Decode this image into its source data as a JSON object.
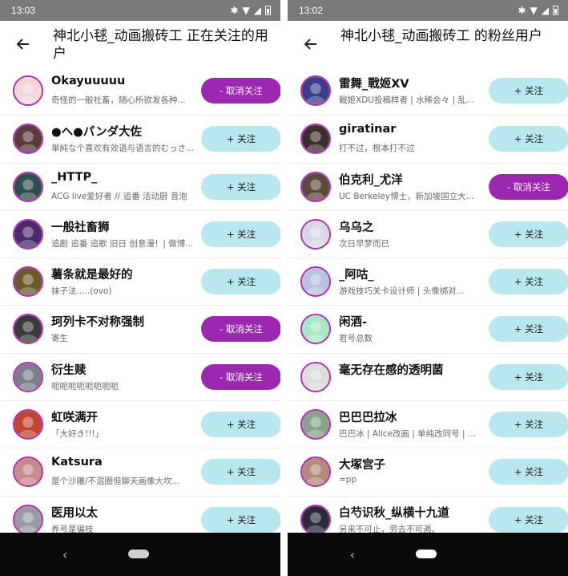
{
  "colors": {
    "accent_purple": "#9c27b0",
    "follow_bg": "#b8e7ef",
    "status_gray": "#7a7a7a",
    "nav_black": "#0a0a0a"
  },
  "icons": {
    "back": "arrow-left-icon",
    "bluetooth": "bluetooth-icon",
    "wifi": "wifi-icon",
    "signal": "signal-icon",
    "battery": "battery-icon"
  },
  "screens": [
    {
      "status_time": "13:03",
      "title": "神北小毬_动画搬砖工 正在关注的用户",
      "users": [
        {
          "name": "Okayuuuuu",
          "sig": "奇怪的一般社畜，随心所欲发各种...",
          "button": "- 取消关注",
          "state": "unfollow",
          "color": "#f3d6d6"
        },
        {
          "name": "●へ●パンダ大佐",
          "sig": "単純な个喜欢有效语与语言的むっさ...",
          "button": "+ 关注",
          "state": "follow",
          "color": "#5a3a3a"
        },
        {
          "name": "_HTTP_",
          "sig": "ACG live爱好者 // 追番 活动厨 音泡",
          "button": "+ 关注",
          "state": "follow",
          "color": "#2f4f4f"
        },
        {
          "name": "一般社畜狮",
          "sig": "追剧 追番 追歌 旧日 创意漫！| 做博...",
          "button": "+ 关注",
          "state": "follow",
          "color": "#4b2a6b"
        },
        {
          "name": "薯条就是最好的",
          "sig": "抹子法.....(ovo)",
          "button": "+ 关注",
          "state": "follow",
          "color": "#6b5a2a"
        },
        {
          "name": "珂列卡不对称强制",
          "sig": "寄生",
          "button": "- 取消关注",
          "state": "unfollow",
          "color": "#3a3a3a"
        },
        {
          "name": "衍生赎",
          "sig": "呃呃呃呃呃呃呃呃",
          "button": "- 取消关注",
          "state": "unfollow",
          "color": "#7d7d8c"
        },
        {
          "name": "虹咲满开",
          "sig": "「大好き!!!」",
          "button": "+ 关注",
          "state": "follow",
          "color": "#c2452f"
        },
        {
          "name": "Katsura",
          "sig": "是个沙雕/不混圈但聊天画像大坎...",
          "button": "+ 关注",
          "state": "follow",
          "color": "#c58a8a"
        },
        {
          "name": "医用以太",
          "sig": "养号是骗技",
          "button": "+ 关注",
          "state": "follow",
          "color": "#9a9aa6"
        }
      ]
    },
    {
      "status_time": "13:02",
      "title": "神北小毬_动画搬砖工 的粉丝用户",
      "users": [
        {
          "name": "雷舞_戰姬XV",
          "sig": "戰姬XDU投稿样者 | 水稀会々 | 乱...",
          "button": "+ 关注",
          "state": "follow",
          "color": "#3b3d8a"
        },
        {
          "name": "giratinar",
          "sig": "打不过，根本打不过",
          "button": "+ 关注",
          "state": "follow",
          "color": "#3a2f2a"
        },
        {
          "name": "伯克利_尤洋",
          "sig": "UC Berkeley博士，新加坡国立大...",
          "button": "- 取消关注",
          "state": "unfollow",
          "color": "#5a4a3a"
        },
        {
          "name": "乌乌之",
          "sig": "次日早梦而已",
          "button": "+ 关注",
          "state": "follow",
          "color": "#d9d9e6"
        },
        {
          "name": "_阿咕_",
          "sig": "游戏技巧关卡设计师 | 头像绑对...",
          "button": "+ 关注",
          "state": "follow",
          "color": "#b9c2df"
        },
        {
          "name": "闲酒-",
          "sig": "君号总数",
          "button": "+ 关注",
          "state": "follow",
          "color": "#a7e8c4"
        },
        {
          "name": "毫无存在感的透明菌",
          "sig": "",
          "button": "+ 关注",
          "state": "follow",
          "color": "#dddddd"
        },
        {
          "name": "巴巴巴拉冰",
          "sig": "巴巴冰 | Alice改画 | 单纯改同号 | 有...",
          "button": "+ 关注",
          "state": "follow",
          "color": "#8aa38a"
        },
        {
          "name": "大塚宫子",
          "sig": "=pp",
          "button": "+ 关注",
          "state": "follow",
          "color": "#b48a7a"
        },
        {
          "name": "白芍识秋_纵横十九道",
          "sig": "另来不可止，劳去不可遏。",
          "button": "+ 关注",
          "state": "follow",
          "color": "#2a2a3a"
        }
      ]
    }
  ]
}
